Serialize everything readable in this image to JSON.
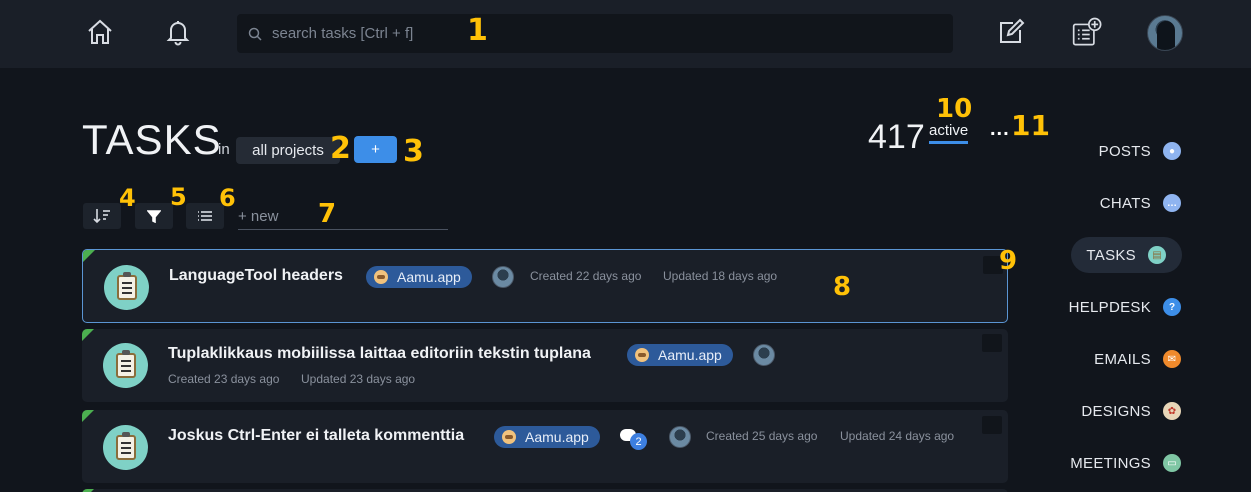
{
  "topbar": {
    "home_icon": "home-icon",
    "notifications_icon": "bell-icon",
    "search_placeholder": "search tasks [Ctrl + f]",
    "new_post_icon": "edit-icon",
    "new_task_icon": "add-task-icon",
    "avatar": "user-avatar"
  },
  "annotations": [
    "1",
    "2",
    "3",
    "4",
    "5",
    "6",
    "7",
    "8",
    "9",
    "10",
    "11"
  ],
  "header": {
    "title": "TASKS",
    "in_label": "in",
    "project_select": "all projects",
    "add_label": "+",
    "count": "417",
    "active_tab": "active",
    "more_label": "...",
    "tab_underline_color": "#3d8ee8"
  },
  "toolbar": {
    "sort_icon": "sort-icon",
    "filter_icon": "filter-icon",
    "list_icon": "list-view-icon",
    "new_placeholder": "+ new"
  },
  "tasks": [
    {
      "title": "LanguageTool headers",
      "project": "Aamu.app",
      "created": "Created 22 days ago",
      "updated": "Updated 18 days ago",
      "comments": ""
    },
    {
      "title": "Tuplaklikkaus mobiilissa laittaa editoriin tekstin tuplana",
      "project": "Aamu.app",
      "created": "Created 23 days ago",
      "updated": "Updated 23 days ago",
      "comments": ""
    },
    {
      "title": "Joskus Ctrl-Enter ei talleta kommenttia",
      "project": "Aamu.app",
      "created": "Created 25 days ago",
      "updated": "Updated 24 days ago",
      "comments": "2"
    }
  ],
  "right_nav": [
    {
      "label": "POSTS",
      "icon": "posts-icon",
      "color": "#8fb4f0"
    },
    {
      "label": "CHATS",
      "icon": "chats-icon",
      "color": "#8fb4f0"
    },
    {
      "label": "TASKS",
      "icon": "tasks-icon",
      "color": "#7fd1c6",
      "active": true
    },
    {
      "label": "HELPDESK",
      "icon": "helpdesk-icon",
      "color": "#3d8ee8"
    },
    {
      "label": "EMAILS",
      "icon": "emails-icon",
      "color": "#f08a2c"
    },
    {
      "label": "DESIGNS",
      "icon": "designs-icon",
      "color": "#e8d6b8"
    },
    {
      "label": "MEETINGS",
      "icon": "meetings-icon",
      "color": "#7fc6a4"
    }
  ],
  "colors": {
    "background": "#11151c",
    "card": "#1a1f28",
    "accent": "#3d8ee8",
    "annotation": "#ffc107",
    "status_green": "#4caf50"
  }
}
